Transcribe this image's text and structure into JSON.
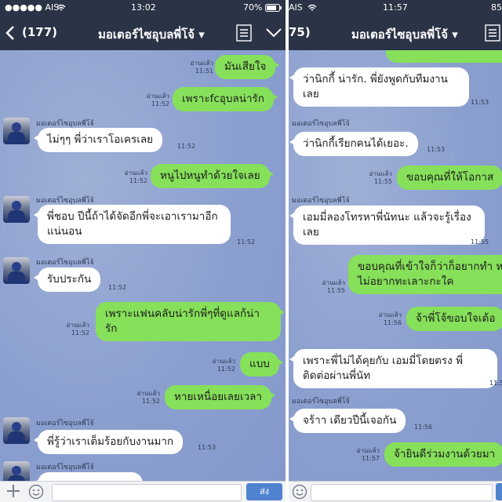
{
  "left": {
    "status": {
      "signal": "●●●●● AIS",
      "time": "13:02",
      "battery": "70%"
    },
    "nav": {
      "back_count": "(177)",
      "title": "มอเตอร์ไซอุบลพี่โจ้ ▾"
    },
    "messages": [
      {
        "dir": "out",
        "text": "มันเสียใจ",
        "read": "อ่านแล้ว",
        "time": "11:51"
      },
      {
        "dir": "out",
        "text": "เพราะfcอุบลน่ารัก",
        "read": "อ่านแล้ว",
        "time": "11:52"
      },
      {
        "dir": "in",
        "sender": "มอเตอร์ไซอุบลพี่โจ้",
        "text": "ไม่ๆๆ พี่ว่าเราโอเครเลย",
        "time": "11:52"
      },
      {
        "dir": "out",
        "text": "หนูไปหนูทำด้วยใจเลย",
        "read": "อ่านแล้ว",
        "time": "11:52"
      },
      {
        "dir": "in",
        "sender": "มอเตอร์ไซอุบลพี่โจ้",
        "text": "พี่ชอบ ปีนี้ถ้าได้จัดอีกพี่จะเอาเรามาอีกแน่นอน",
        "time": "11:52"
      },
      {
        "dir": "in",
        "sender": "มอเตอร์ไซอุบลพี่โจ้",
        "text": "รับประกัน",
        "time": "11:52"
      },
      {
        "dir": "out",
        "text": "เพราะแฟนคลับน่ารักพี่ๆที่ดูแลก้น่ารัก",
        "read": "อ่านแล้ว",
        "time": "11:52"
      },
      {
        "dir": "out",
        "text": "แบบ",
        "read": "อ่านแล้ว",
        "time": "11:52"
      },
      {
        "dir": "out",
        "text": "หายเหนื่อยเลยเวลา",
        "read": "อ่านแล้ว",
        "time": "11:52"
      },
      {
        "dir": "in",
        "sender": "มอเตอร์ไซอุบลพี่โจ้",
        "text": "พี่รู้ว่าเราเต็มร้อยกับงานมาก",
        "time": "11:53"
      },
      {
        "dir": "in",
        "sender": "มอเตอร์ไซอุบลพี่โจ้",
        "text": "",
        "time": ""
      }
    ],
    "composer": {
      "send_label": "ส่ง"
    }
  },
  "right": {
    "status": {
      "signal": "AIS",
      "time": "11:57",
      "battery": "85"
    },
    "nav": {
      "back_count": "75)",
      "title": "มอเตอร์ไซอุบลพี่โจ้ ▾"
    },
    "messages": [
      {
        "dir": "in",
        "text": "ว่านิกกี้ น่ารัก. พี่ยังพูดกับทีมงานเลย",
        "time": "11:53"
      },
      {
        "dir": "in",
        "sender": "มอเตอร์ไซอุบลพี่โจ้",
        "text": "ว่านิกกี้เรียกคนได้เยอะ.",
        "time": "11:53"
      },
      {
        "dir": "out",
        "text": "ขอบคุณที่ให้โอกาส",
        "read": "อ่านแล้ว",
        "time": "11:55"
      },
      {
        "dir": "in",
        "sender": "มอเตอร์ไซอุบลพี่โจ้",
        "text": "เอมมี่ลองโทรหาพี่นัทนะ แล้วจะรู้เรื่องเลย",
        "time": "11:55"
      },
      {
        "dir": "out",
        "text": "ขอบคุณที่เข้าใจก็ว่าก็อยากทำ หาเงินไม่อยากทะเลาะกะใค",
        "read": "อ่านแล้ว",
        "time": "11:55"
      },
      {
        "dir": "out",
        "text": "จ้าพี่โจ้ขอบใจเด้อ",
        "read": "อ่านแล้ว",
        "time": "11:56"
      },
      {
        "dir": "in",
        "text": "เพราะพี่ไม่ได้คุยกับ เอมมี่โดยตรง พี่ติดต่อผ่านพี่นัท",
        "time": "11:56"
      },
      {
        "dir": "in",
        "sender": "มอเตอร์ไซอุบลพี่โจ้",
        "text": "จร้าา เดียวปีนี้เจอกัน",
        "time": "11:56"
      },
      {
        "dir": "out",
        "text": "จ้ายินดีร่วมงานด้วยมา",
        "read": "อ่านแล้ว",
        "time": "11:57"
      }
    ]
  },
  "icons": {
    "back": "chevron-left",
    "menu": "list-menu",
    "collapse": "chevron-down",
    "add": "plus",
    "emoji": "smiley"
  }
}
